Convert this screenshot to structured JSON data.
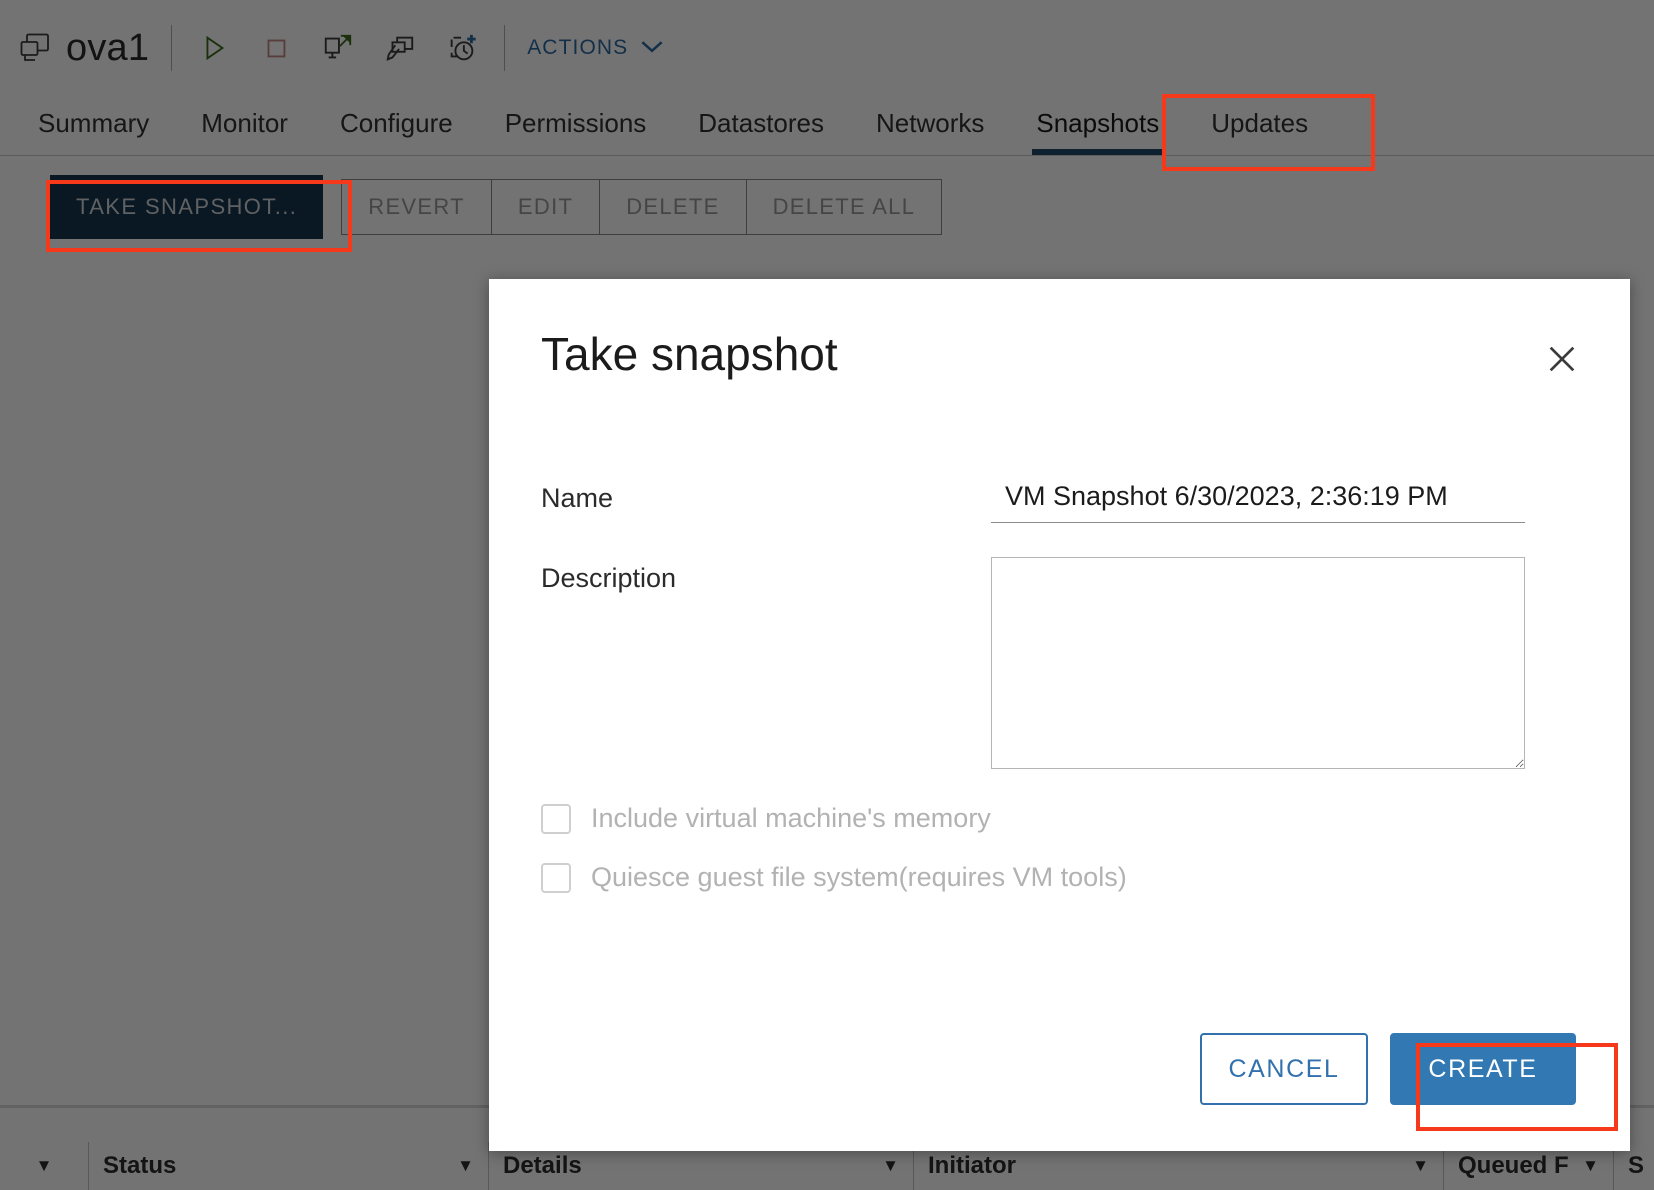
{
  "header": {
    "vm_icon": "virtual-machine-icon",
    "title": "ova1",
    "toolbar_icons": [
      {
        "name": "power-on-icon",
        "label": "Power On"
      },
      {
        "name": "power-off-icon",
        "label": "Power Off"
      },
      {
        "name": "launch-web-console-icon",
        "label": "Launch Web Console"
      },
      {
        "name": "edit-vm-icon",
        "label": "Edit"
      },
      {
        "name": "take-snapshot-icon",
        "label": "Take Snapshot"
      }
    ],
    "actions_label": "ACTIONS",
    "actions_caret": "chevron-down-icon"
  },
  "tabs": [
    {
      "label": "Summary",
      "active": false
    },
    {
      "label": "Monitor",
      "active": false
    },
    {
      "label": "Configure",
      "active": false
    },
    {
      "label": "Permissions",
      "active": false
    },
    {
      "label": "Datastores",
      "active": false
    },
    {
      "label": "Networks",
      "active": false
    },
    {
      "label": "Snapshots",
      "active": true
    },
    {
      "label": "Updates",
      "active": false
    }
  ],
  "toolbar": {
    "take_snapshot_label": "TAKE SNAPSHOT...",
    "secondary_buttons": [
      {
        "label": "REVERT",
        "disabled": true
      },
      {
        "label": "EDIT",
        "disabled": true
      },
      {
        "label": "DELETE",
        "disabled": true
      },
      {
        "label": "DELETE ALL",
        "disabled": true
      }
    ]
  },
  "dialog": {
    "title": "Take snapshot",
    "close_icon": "close-icon",
    "name_label": "Name",
    "name_value": "VM Snapshot 6/30/2023, 2:36:19 PM",
    "description_label": "Description",
    "description_value": "",
    "checkboxes": [
      {
        "label": "Include virtual machine's memory",
        "checked": false,
        "disabled": true
      },
      {
        "label": "Quiesce guest file system(requires VM tools)",
        "checked": false,
        "disabled": true
      }
    ],
    "cancel_label": "CANCEL",
    "create_label": "CREATE"
  },
  "task_table": {
    "columns": [
      {
        "label": "Status",
        "caret": "filter-caret-icon"
      },
      {
        "label": "Details",
        "caret": "filter-caret-icon"
      },
      {
        "label": "Initiator",
        "caret": "filter-caret-icon"
      },
      {
        "label": "Queued F",
        "caret": "filter-caret-icon"
      },
      {
        "label": "S",
        "caret": "filter-caret-icon"
      }
    ]
  },
  "colors": {
    "accent_blue": "#3279b3",
    "dark_navy": "#17374f",
    "annotation_red": "#f5391a",
    "tab_underline": "#1e4a6d"
  }
}
